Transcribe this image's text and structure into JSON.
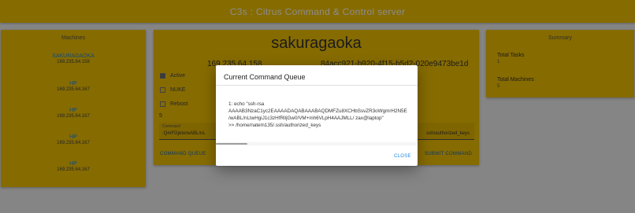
{
  "app": {
    "title": "C3s : Citrus Command & Control server"
  },
  "machines": {
    "header": "Machines",
    "items": [
      {
        "name": "SAKURAGAOKA",
        "ip": "169.235.64.158"
      },
      {
        "name": "HP",
        "ip": "169.235.64.167"
      },
      {
        "name": "HP",
        "ip": "169.235.64.167"
      },
      {
        "name": "HP",
        "ip": "169.235.64.167"
      },
      {
        "name": "HP",
        "ip": "169.235.64.167"
      }
    ]
  },
  "main": {
    "hostname": "sakuragaoka",
    "ip": "169.235.64.158",
    "uuid": "84acc921-b920-4f15-b5d2-020e9473be1d",
    "options": [
      {
        "label": "Active",
        "checked": true
      },
      {
        "label": "NUKE",
        "checked": false
      },
      {
        "label": "Reboot",
        "checked": false
      }
    ],
    "interval": "5",
    "command_label": "Command",
    "command_value": ":QmFGjetx/wABL/nL",
    "command_value_tail": "ssh/authorized_keys",
    "queue_button": "COMMAND QUEUE",
    "submit_button": "SUBMIT COMMAND"
  },
  "summary": {
    "header": "Summary",
    "total_tasks_label": "Total Tasks",
    "total_tasks_value": "1",
    "total_machines_label": "Total Machines",
    "total_machines_value": "5"
  },
  "dialog": {
    "title": "Current Command Queue",
    "lines": [
      "1: echo \"ssh-rsa",
      "AAAAB3NzaC1yc2EAAAADAQABAAABAQDMFZu8XCHbSsvZR3oWgmrH2N5E",
      "/wABL/nLtwHgiJ1c3zHfRlIjGw0/VM+mh6VLpH4AAJMLL/ zax@laptop\"",
      ">> /home/natem135/.ssh/authorized_keys"
    ],
    "close_button": "CLOSE"
  }
}
